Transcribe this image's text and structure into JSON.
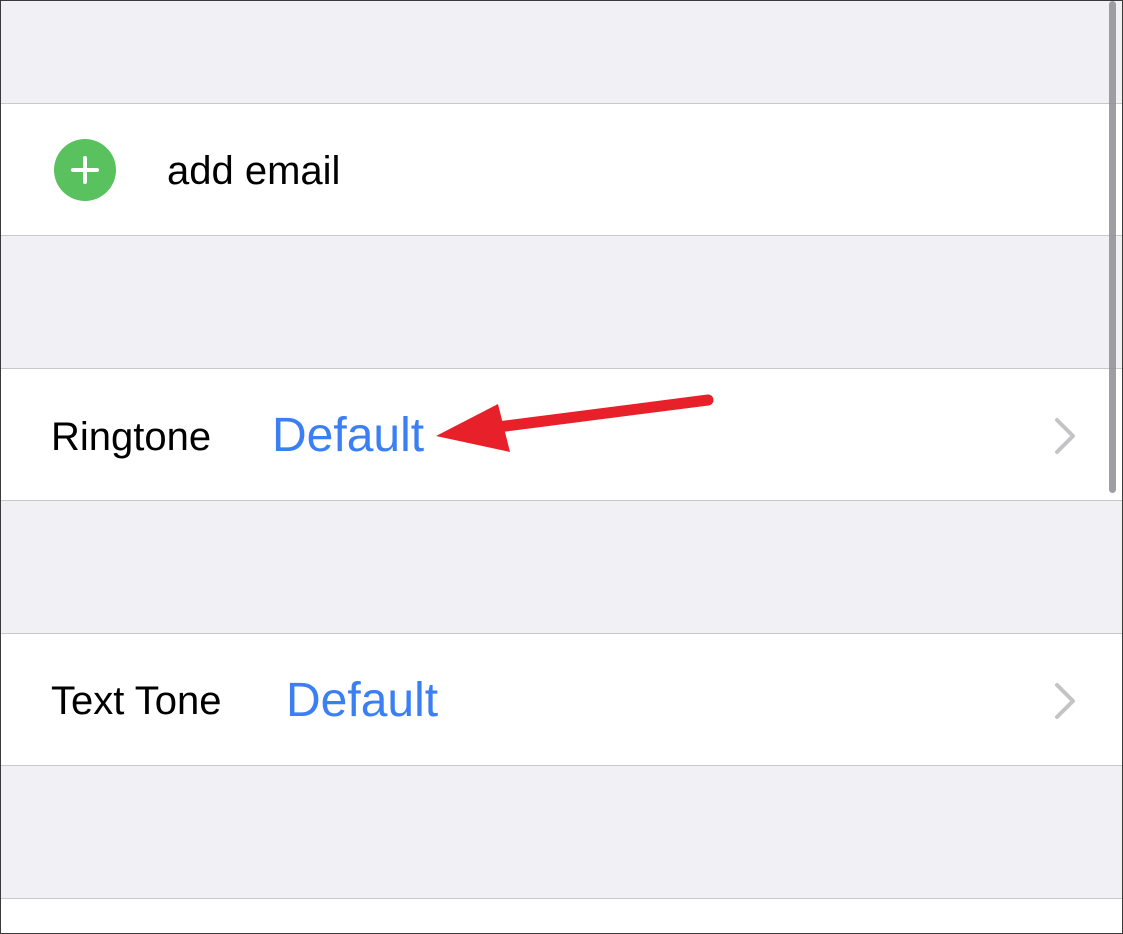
{
  "add_email": {
    "label": "add email",
    "icon": "plus-circle-icon",
    "icon_color": "#5ac15f"
  },
  "ringtone": {
    "label": "Ringtone",
    "value": "Default",
    "chevron_icon": "chevron-right-icon"
  },
  "text_tone": {
    "label": "Text Tone",
    "value": "Default",
    "chevron_icon": "chevron-right-icon"
  },
  "annotation": {
    "type": "red-arrow",
    "color": "#e8202a",
    "points_to": "ringtone.value"
  },
  "colors": {
    "group_background": "#f0f0f5",
    "cell_background": "#ffffff",
    "separator": "#c8c7cc",
    "accent_blue": "#3b7ff5",
    "chevron": "#c4c4c7"
  }
}
